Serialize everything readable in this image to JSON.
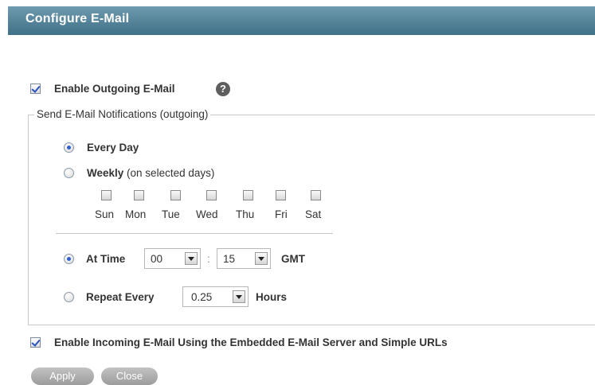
{
  "header": {
    "title": "Configure E-Mail"
  },
  "outgoing": {
    "enable_label": "Enable Outgoing E-Mail",
    "enabled": true,
    "help_symbol": "?"
  },
  "notifications": {
    "legend": "Send E-Mail Notifications (outgoing)",
    "every_day": {
      "label": "Every Day",
      "selected": true
    },
    "weekly": {
      "label": "Weekly",
      "suffix": "(on selected days)",
      "selected": false
    },
    "days": [
      {
        "label": "Sun",
        "checked": false
      },
      {
        "label": "Mon",
        "checked": false
      },
      {
        "label": "Tue",
        "checked": false
      },
      {
        "label": "Wed",
        "checked": false
      },
      {
        "label": "Thu",
        "checked": false
      },
      {
        "label": "Fri",
        "checked": false
      },
      {
        "label": "Sat",
        "checked": false
      }
    ],
    "at_time": {
      "label": "At Time",
      "selected": true,
      "hour": "00",
      "separator": ":",
      "minute": "15",
      "zone": "GMT"
    },
    "repeat_every": {
      "label": "Repeat Every",
      "selected": false,
      "value": "0.25",
      "unit": "Hours"
    }
  },
  "incoming": {
    "enable_label": "Enable Incoming E-Mail Using the Embedded E-Mail Server and Simple URLs",
    "enabled": true
  },
  "buttons": {
    "apply": "Apply",
    "close": "Close"
  },
  "colors": {
    "header_top": "#6f9aaf",
    "header_bottom": "#3f7187",
    "button": "#aaaaaa"
  }
}
